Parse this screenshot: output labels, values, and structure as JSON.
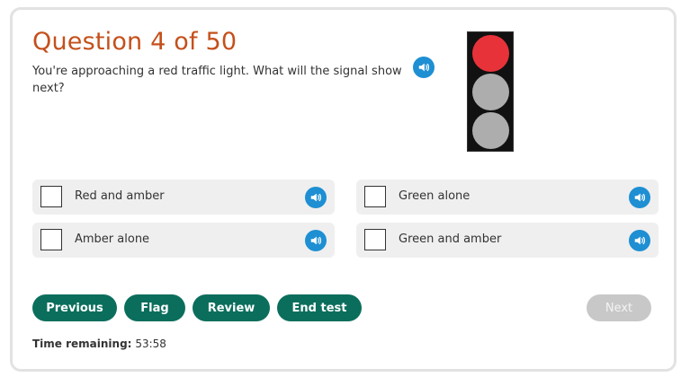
{
  "question": {
    "title": "Question 4 of 50",
    "text": "You're approaching a red traffic light. What will the signal show next?"
  },
  "traffic_light": {
    "lamps": [
      {
        "state": "on",
        "color": "#e8323a"
      },
      {
        "state": "off",
        "color": "#adadad"
      },
      {
        "state": "off",
        "color": "#adadad"
      }
    ]
  },
  "answers": [
    {
      "label": "Red and amber",
      "checked": false
    },
    {
      "label": "Green alone",
      "checked": false
    },
    {
      "label": "Amber alone",
      "checked": false
    },
    {
      "label": "Green and amber",
      "checked": false
    }
  ],
  "buttons": {
    "previous": "Previous",
    "flag": "Flag",
    "review": "Review",
    "end_test": "End test",
    "next": "Next"
  },
  "timer": {
    "label": "Time remaining:",
    "value": "53:58"
  },
  "colors": {
    "title": "#c4501b",
    "button": "#0b6e5c",
    "speaker": "#1e8fd3",
    "disabled": "#c8c8c8"
  },
  "icons": {
    "speaker": "speaker-volume-icon"
  }
}
